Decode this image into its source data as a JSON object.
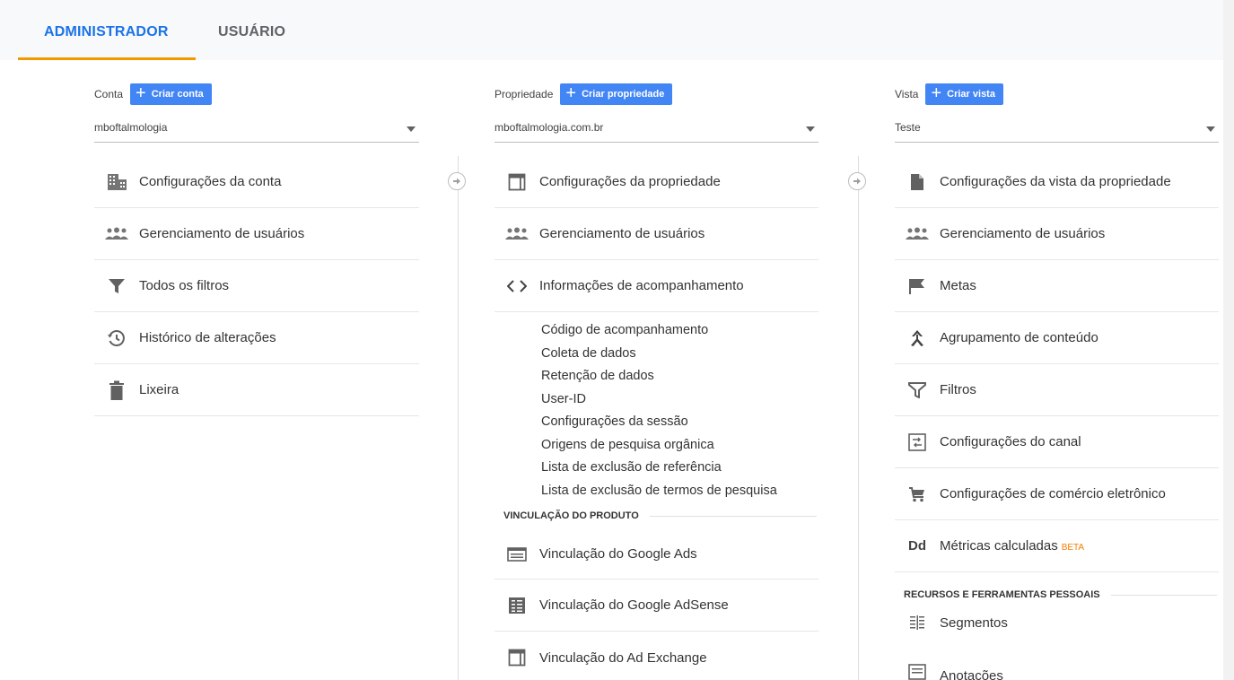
{
  "tabs": {
    "admin": "ADMINISTRADOR",
    "user": "USUÁRIO"
  },
  "colors": {
    "accent": "#1a73e8",
    "tab_underline": "#f29900",
    "button": "#4285f4",
    "beta": "#f57c00"
  },
  "account": {
    "label": "Conta",
    "create": "Criar conta",
    "selected": "mboftalmologia",
    "items": [
      {
        "icon": "building-icon",
        "label": "Configurações da conta"
      },
      {
        "icon": "people-icon",
        "label": "Gerenciamento de usuários"
      },
      {
        "icon": "filter-icon",
        "label": "Todos os filtros"
      },
      {
        "icon": "history-icon",
        "label": "Histórico de alterações"
      },
      {
        "icon": "trash-icon",
        "label": "Lixeira"
      }
    ]
  },
  "property": {
    "label": "Propriedade",
    "create": "Criar propriedade",
    "selected": "mboftalmologia.com.br",
    "items": [
      {
        "icon": "window-icon",
        "label": "Configurações da propriedade"
      },
      {
        "icon": "people-icon",
        "label": "Gerenciamento de usuários"
      },
      {
        "icon": "code-icon",
        "label": "Informações de acompanhamento"
      }
    ],
    "tracking_subitems": [
      "Código de acompanhamento",
      "Coleta de dados",
      "Retenção de dados",
      "User-ID",
      "Configurações da sessão",
      "Origens de pesquisa orgânica",
      "Lista de exclusão de referência",
      "Lista de exclusão de termos de pesquisa"
    ],
    "linking_header": "VINCULAÇÃO DO PRODUTO",
    "linking_items": [
      {
        "icon": "google-ads-icon",
        "label": "Vinculação do Google Ads"
      },
      {
        "icon": "adsense-icon",
        "label": "Vinculação do Google AdSense"
      },
      {
        "icon": "ad-exchange-icon",
        "label": "Vinculação do Ad Exchange"
      }
    ]
  },
  "view": {
    "label": "Vista",
    "create": "Criar vista",
    "selected": "Teste",
    "items": [
      {
        "icon": "document-icon",
        "label": "Configurações da vista da propriedade"
      },
      {
        "icon": "people-icon",
        "label": "Gerenciamento de usuários"
      },
      {
        "icon": "flag-icon",
        "label": "Metas"
      },
      {
        "icon": "grouping-icon",
        "label": "Agrupamento de conteúdo"
      },
      {
        "icon": "filter-icon",
        "label": "Filtros"
      },
      {
        "icon": "channel-icon",
        "label": "Configurações do canal"
      },
      {
        "icon": "cart-icon",
        "label": "Configurações de comércio eletrônico"
      },
      {
        "icon": "calculated-metrics-icon",
        "label": "Métricas calculadas",
        "badge": "BETA"
      }
    ],
    "personal_header": "RECURSOS E FERRAMENTAS PESSOAIS",
    "personal_items": [
      {
        "icon": "segments-icon",
        "label": "Segmentos"
      },
      {
        "icon": "annotations-icon",
        "label": "Anotações"
      }
    ]
  }
}
